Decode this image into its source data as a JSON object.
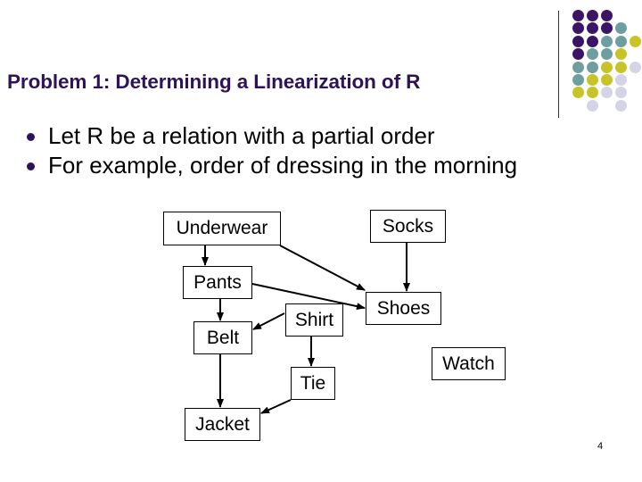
{
  "slide": {
    "title": "Problem 1: Determining a Linearization of R",
    "bullets": [
      "Let R be a relation with a partial order",
      "For example, order of dressing in the morning"
    ],
    "page_number": "4"
  },
  "diagram": {
    "nodes": [
      {
        "id": "underwear",
        "label": "Underwear"
      },
      {
        "id": "socks",
        "label": "Socks"
      },
      {
        "id": "pants",
        "label": "Pants"
      },
      {
        "id": "shoes",
        "label": "Shoes"
      },
      {
        "id": "belt",
        "label": "Belt"
      },
      {
        "id": "shirt",
        "label": "Shirt"
      },
      {
        "id": "tie",
        "label": "Tie"
      },
      {
        "id": "watch",
        "label": "Watch"
      },
      {
        "id": "jacket",
        "label": "Jacket"
      }
    ],
    "edges": [
      {
        "from": "underwear",
        "to": "pants"
      },
      {
        "from": "underwear",
        "to": "shoes"
      },
      {
        "from": "socks",
        "to": "shoes"
      },
      {
        "from": "pants",
        "to": "shoes"
      },
      {
        "from": "pants",
        "to": "belt"
      },
      {
        "from": "shirt",
        "to": "belt"
      },
      {
        "from": "shirt",
        "to": "tie"
      },
      {
        "from": "belt",
        "to": "jacket"
      },
      {
        "from": "tie",
        "to": "jacket"
      }
    ]
  },
  "theme": {
    "title_color": "#2e1457",
    "dot_colors": {
      "purple": "#3b1466",
      "teal": "#6f9ea0",
      "olive": "#c8c428",
      "lavender": "#d4d4e6"
    }
  }
}
